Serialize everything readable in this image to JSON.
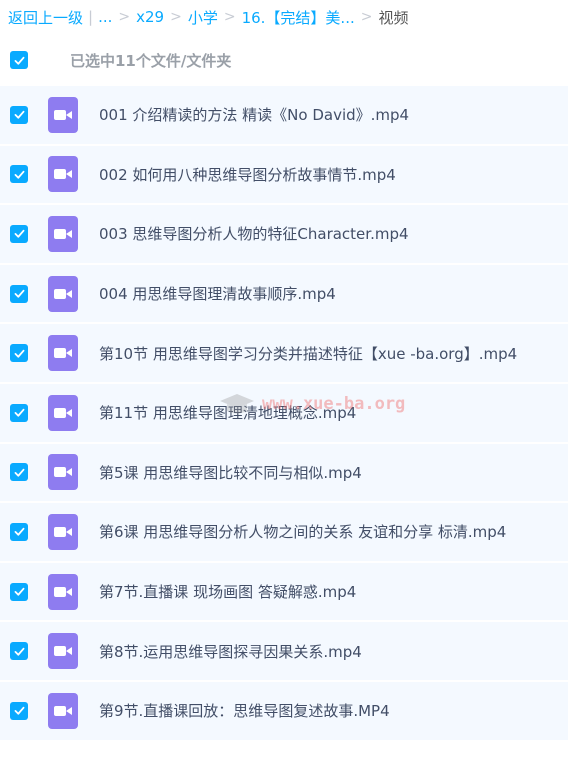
{
  "breadcrumb": {
    "back": "返回上一级",
    "pipe": "|",
    "ellipsis": "...",
    "sep": ">",
    "items": [
      "x29",
      "小学",
      "16.【完结】美..."
    ],
    "current": "视频"
  },
  "selection": {
    "label": "已选中11个文件/文件夹"
  },
  "files": [
    "001 介绍精读的方法 精读《No David》.mp4",
    "002 如何用八种思维导图分析故事情节.mp4",
    "003 思维导图分析人物的特征Character.mp4",
    "004 用思维导图理清故事顺序.mp4",
    "第10节 用思维导图学习分类并描述特征【xue -ba.org】.mp4",
    "第11节 用思维导图理清地理概念.mp4",
    "第5课 用思维导图比较不同与相似.mp4",
    "第6课 用思维导图分析人物之间的关系 友谊和分享 标清.mp4",
    "第7节.直播课 现场画图 答疑解惑.mp4",
    "第8节.运用思维导图探寻因果关系.mp4",
    "第9节.直播课回放：思维导图复述故事.MP4"
  ],
  "watermark": "www.xue-ba.org",
  "colors": {
    "accent": "#09aaff",
    "video_icon": "#8e7cf0",
    "row_bg": "#f4f9ff"
  }
}
